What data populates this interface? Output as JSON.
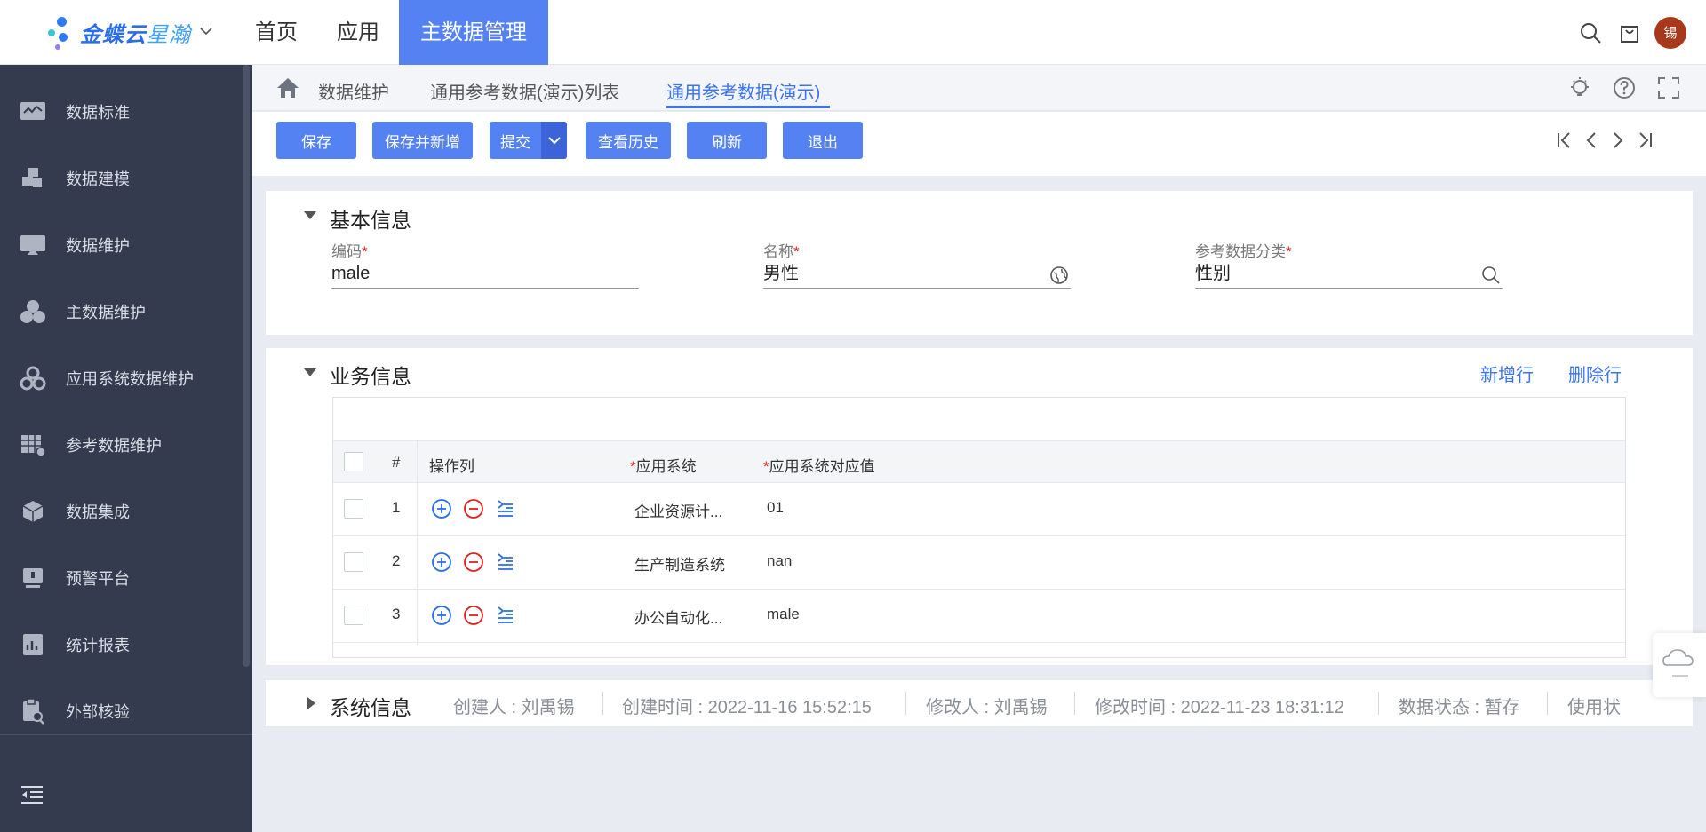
{
  "app": {
    "logo_main": "金蝶云",
    "logo_sub": "星瀚"
  },
  "topnav": {
    "items": [
      {
        "label": "首页"
      },
      {
        "label": "应用"
      },
      {
        "label": "主数据管理"
      }
    ]
  },
  "user": {
    "avatar_text": "锡"
  },
  "sidebar": {
    "items": [
      {
        "label": "数据标准",
        "icon": "chart-monitor-icon"
      },
      {
        "label": "数据建模",
        "icon": "puzzle-icon"
      },
      {
        "label": "数据维护",
        "icon": "monitor-icon"
      },
      {
        "label": "主数据维护",
        "icon": "circles-icon"
      },
      {
        "label": "应用系统数据维护",
        "icon": "app-circles-icon"
      },
      {
        "label": "参考数据维护",
        "icon": "table-gear-icon"
      },
      {
        "label": "数据集成",
        "icon": "cube-icon"
      },
      {
        "label": "预警平台",
        "icon": "alert-board-icon"
      },
      {
        "label": "统计报表",
        "icon": "report-icon"
      },
      {
        "label": "外部核验",
        "icon": "clipboard-search-icon"
      }
    ]
  },
  "breadcrumb": {
    "items": [
      {
        "label": "数据维护"
      },
      {
        "label": "通用参考数据(演示)列表"
      },
      {
        "label": "通用参考数据(演示)"
      }
    ]
  },
  "toolbar": {
    "save": "保存",
    "save_new": "保存并新增",
    "submit": "提交",
    "history": "查看历史",
    "refresh": "刷新",
    "exit": "退出"
  },
  "basic": {
    "title": "基本信息",
    "code_label": "编码",
    "code_value": "male",
    "name_label": "名称",
    "name_value": "男性",
    "category_label": "参考数据分类",
    "category_value": "性别",
    "required_mark": "*"
  },
  "business": {
    "title": "业务信息",
    "add_row": "新增行",
    "delete_row": "删除行",
    "columns": {
      "index": "#",
      "actions": "操作列",
      "app_system": "应用系统",
      "app_value": "应用系统对应值"
    },
    "rows": [
      {
        "index": "1",
        "app_system": "企业资源计...",
        "app_value": "01"
      },
      {
        "index": "2",
        "app_system": "生产制造系统",
        "app_value": "nan"
      },
      {
        "index": "3",
        "app_system": "办公自动化...",
        "app_value": "male"
      }
    ]
  },
  "system": {
    "title": "系统信息",
    "creator": "创建人 : 刘禹锡",
    "created_at": "创建时间 : 2022-11-16 15:52:15",
    "modifier": "修改人 : 刘禹锡",
    "modified_at": "修改时间 : 2022-11-23 18:31:12",
    "status": "数据状态 : 暂存",
    "usage": "使用状"
  },
  "colors": {
    "primary": "#5582f3",
    "sidebar_bg": "#343b4f",
    "link": "#3b74f0",
    "danger": "#e02020"
  }
}
